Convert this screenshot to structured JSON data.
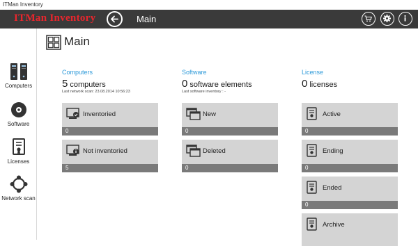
{
  "window": {
    "title": "ITMan Inventory"
  },
  "header": {
    "logo": "ITMan Inventory",
    "title": "Main"
  },
  "sidebar": {
    "items": [
      {
        "label": "Computers"
      },
      {
        "label": "Software"
      },
      {
        "label": "Licenses"
      },
      {
        "label": "Network scan"
      }
    ]
  },
  "main": {
    "title": "Main",
    "computers": {
      "heading": "Computers",
      "count": "5",
      "unit": "computers",
      "sub": "Last network scan: 23.08.2014 10:56:23",
      "tiles": [
        {
          "label": "Inventoried",
          "value": "0"
        },
        {
          "label": "Not inventoried",
          "value": "5"
        }
      ]
    },
    "software": {
      "heading": "Software",
      "count": "0",
      "unit": "software elements",
      "sub": "Last software inventory : -",
      "tiles": [
        {
          "label": "New",
          "value": "0"
        },
        {
          "label": "Deleted",
          "value": "0"
        }
      ]
    },
    "license": {
      "heading": "License",
      "count": "0",
      "unit": "licenses",
      "tiles": [
        {
          "label": "Active",
          "value": "0"
        },
        {
          "label": "Ending",
          "value": "0"
        },
        {
          "label": "Ended",
          "value": "0"
        },
        {
          "label": "Archive",
          "value": ""
        }
      ]
    }
  },
  "colors": {
    "accent": "#2e9ad9",
    "topbar": "#3a3a3a",
    "logo": "#e8262d",
    "tile": "#d4d4d4",
    "tile_bar": "#7a7a7a"
  },
  "icons": [
    "back-arrow-icon",
    "cart-icon",
    "gear-icon",
    "info-icon",
    "computers-icon",
    "software-disc-icon",
    "license-icon",
    "network-scan-icon"
  ]
}
